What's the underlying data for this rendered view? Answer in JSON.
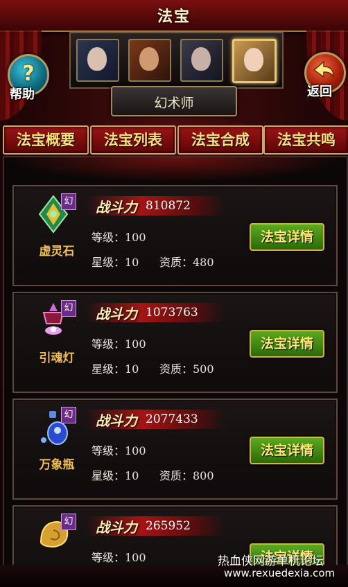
{
  "header": {
    "title": "法宝"
  },
  "buttons": {
    "help_glyph": "?",
    "help_label": "帮助",
    "back_label": "返回"
  },
  "characters": {
    "class_label": "幻术师",
    "portraits": [
      "character-1",
      "character-2",
      "character-3",
      "character-4"
    ],
    "selected": 4
  },
  "tabs": [
    "法宝概要",
    "法宝列表",
    "法宝合成",
    "法宝共鸣"
  ],
  "cards": [
    {
      "name": "虚灵石",
      "badge": "幻",
      "power_label": "战斗力",
      "power": "810872",
      "level": "等级：100",
      "star": "星级：10",
      "quality": "资质：480",
      "button": "法宝详情"
    },
    {
      "name": "引魂灯",
      "badge": "幻",
      "power_label": "战斗力",
      "power": "1073763",
      "level": "等级：100",
      "star": "星级：10",
      "quality": "资质：500",
      "button": "法宝详情"
    },
    {
      "name": "万象瓶",
      "badge": "幻",
      "power_label": "战斗力",
      "power": "2077433",
      "level": "等级：100",
      "star": "星级：10",
      "quality": "资质：800",
      "button": "法宝详情"
    },
    {
      "name": "",
      "badge": "幻",
      "power_label": "战斗力",
      "power": "265952",
      "level": "等级：100",
      "star": "",
      "quality": "",
      "button": "法宝详情"
    }
  ],
  "watermark": {
    "line1": "热血侠网游单机论坛",
    "line2": "www.rexuedexia.com"
  },
  "colors": {
    "accent_gold": "#e8c870",
    "button_green": "#4a9a18",
    "tab_red": "#8a1010",
    "badge_purple": "#6c2a8a"
  }
}
